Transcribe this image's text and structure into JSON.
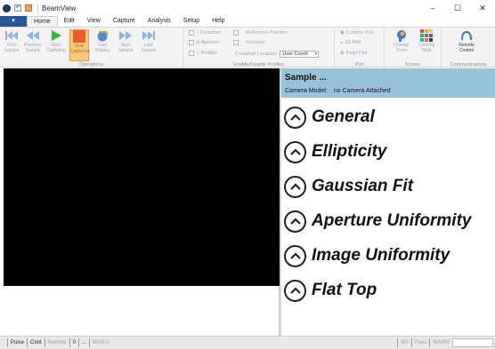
{
  "window": {
    "title": "BeamView",
    "controls": {
      "minimize": "–",
      "maximize": "☐",
      "close": "✕"
    }
  },
  "menu": {
    "file_label": "",
    "tabs": [
      {
        "label": "Home",
        "active": true
      },
      {
        "label": "Edit"
      },
      {
        "label": "View"
      },
      {
        "label": "Capture"
      },
      {
        "label": "Analysis"
      },
      {
        "label": "Setup"
      },
      {
        "label": "Help"
      }
    ]
  },
  "ribbon": {
    "operations": {
      "label": "Operations",
      "buttons": [
        {
          "line1": "First",
          "line2": "Sample",
          "icon": "first-icon"
        },
        {
          "line1": "Previous",
          "line2": "Sample",
          "icon": "previous-icon"
        },
        {
          "line1": "Start",
          "line2": "Capturing",
          "icon": "play-icon"
        },
        {
          "line1": "Stop",
          "line2": "Capturing",
          "icon": "stop-icon"
        },
        {
          "line1": "Fast",
          "line2": "Display",
          "icon": "fast-display-icon"
        },
        {
          "line1": "Next",
          "line2": "Sample",
          "icon": "next-icon"
        },
        {
          "line1": "Last",
          "line2": "Sample",
          "icon": "last-icon"
        }
      ]
    },
    "enable": {
      "label": "Enable/Disable Profiles",
      "crosshair": "Crosshair",
      "aperture": "Aperture",
      "profiles": "Profiles",
      "reference_position": "Reference Position",
      "inclusion": "Inclusion",
      "crosshair_location_label": "Crosshair Location:",
      "crosshair_location_value": "User Coord"
    },
    "plot": {
      "label": "Plot",
      "contour": "Contour Plot",
      "plot3d": "3D Plot",
      "polar": "Polar Plot"
    },
    "screen": {
      "label": "Screen",
      "change_zoom_1": "Change",
      "change_zoom_2": "Zoom",
      "coloring_1": "Coloring",
      "coloring_2": "Style"
    },
    "communications": {
      "label": "Communications",
      "remote_1": "Remote",
      "remote_2": "Control"
    }
  },
  "panel": {
    "title": "Sample ...",
    "camera_model_label": "Camera Model:",
    "camera_model_value": "no Camera Attached",
    "sections": [
      "General",
      "Ellipticity",
      "Gaussian Fit",
      "Aperture Uniformity",
      "Image Uniformity",
      "Flat Top"
    ]
  },
  "status": {
    "pulse": "Pulse",
    "cont": "Cont",
    "remote": "Remote",
    "zero": "0",
    "dots": "...",
    "bias": "BIAS:0",
    "bg": "BG",
    "pass": "Pass",
    "warm": "WARM"
  },
  "colors": {
    "panel_header": "#99c3d9",
    "file_tab": "#2b5797",
    "stop_button": "#f7c97e",
    "play": "#3bb44a"
  }
}
